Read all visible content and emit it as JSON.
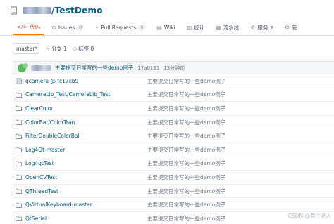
{
  "repo": {
    "name": "/TestDemo",
    "icon": "repo-icon"
  },
  "tabs": [
    {
      "label": "代码",
      "icon": "code-icon",
      "glyph": "</>",
      "active": true,
      "caret": ""
    },
    {
      "label": "Issues",
      "icon": "issues-icon",
      "glyph": "⊙",
      "count": "0",
      "caret": ""
    },
    {
      "label": "Pull Requests",
      "icon": "pull-request-icon",
      "glyph": "⑂",
      "count": "0",
      "caret": ""
    },
    {
      "label": "Wiki",
      "icon": "wiki-icon",
      "glyph": "▤",
      "caret": ""
    },
    {
      "label": "统计",
      "icon": "stats-icon",
      "glyph": "▥",
      "caret": ""
    },
    {
      "label": "流水线",
      "icon": "pipeline-icon",
      "glyph": "▦",
      "caret": ""
    },
    {
      "label": "服务",
      "icon": "service-icon",
      "glyph": "⚙",
      "caret": "▼"
    },
    {
      "label": "管",
      "icon": "manage-icon",
      "glyph": "⚙",
      "caret": ""
    }
  ],
  "toolbar": {
    "branch": "master",
    "branches": "分支 1",
    "tags": "标签 0"
  },
  "commit": {
    "message": "主要提交日常写的一些demo例子",
    "hash": "17a0131",
    "time": "13分钟前"
  },
  "files": [
    {
      "type": "submodule",
      "name": "qcamera @ fc17cb9",
      "message": "主要提交日常写的一些demo例子"
    },
    {
      "type": "folder",
      "name": "CameraLib_Test/CameraLib_Test",
      "message": "主要提交日常写的一些demo例子"
    },
    {
      "type": "folder",
      "name": "ClearColor",
      "message": "主要提交日常写的一些demo例子"
    },
    {
      "type": "folder",
      "name": "ColorBat/ColorTran",
      "message": "主要提交日常写的一些demo例子"
    },
    {
      "type": "folder",
      "name": "FilterDoubleColorBall",
      "message": "主要提交日常写的一些demo例子"
    },
    {
      "type": "folder",
      "name": "Log4Qt-master",
      "message": "主要提交日常写的一些demo例子"
    },
    {
      "type": "folder",
      "name": "Log4qtTest",
      "message": "主要提交日常写的一些demo例子"
    },
    {
      "type": "folder",
      "name": "OpenCVTest",
      "message": "主要提交日常写的一些demo例子"
    },
    {
      "type": "folder",
      "name": "QThreadTest",
      "message": "主要提交日常写的一些demo例子"
    },
    {
      "type": "folder",
      "name": "QVirtualKeyboard-master",
      "message": "主要提交日常写的一些demo例子"
    },
    {
      "type": "folder",
      "name": "QtSerial",
      "message": "主要提交日常写的一些demo例子"
    }
  ],
  "watermark": "CSDN @蓉牛老人",
  "colors": {
    "link": "#005980",
    "accent": "#fe7300",
    "active_tab": "#d55c3b"
  }
}
